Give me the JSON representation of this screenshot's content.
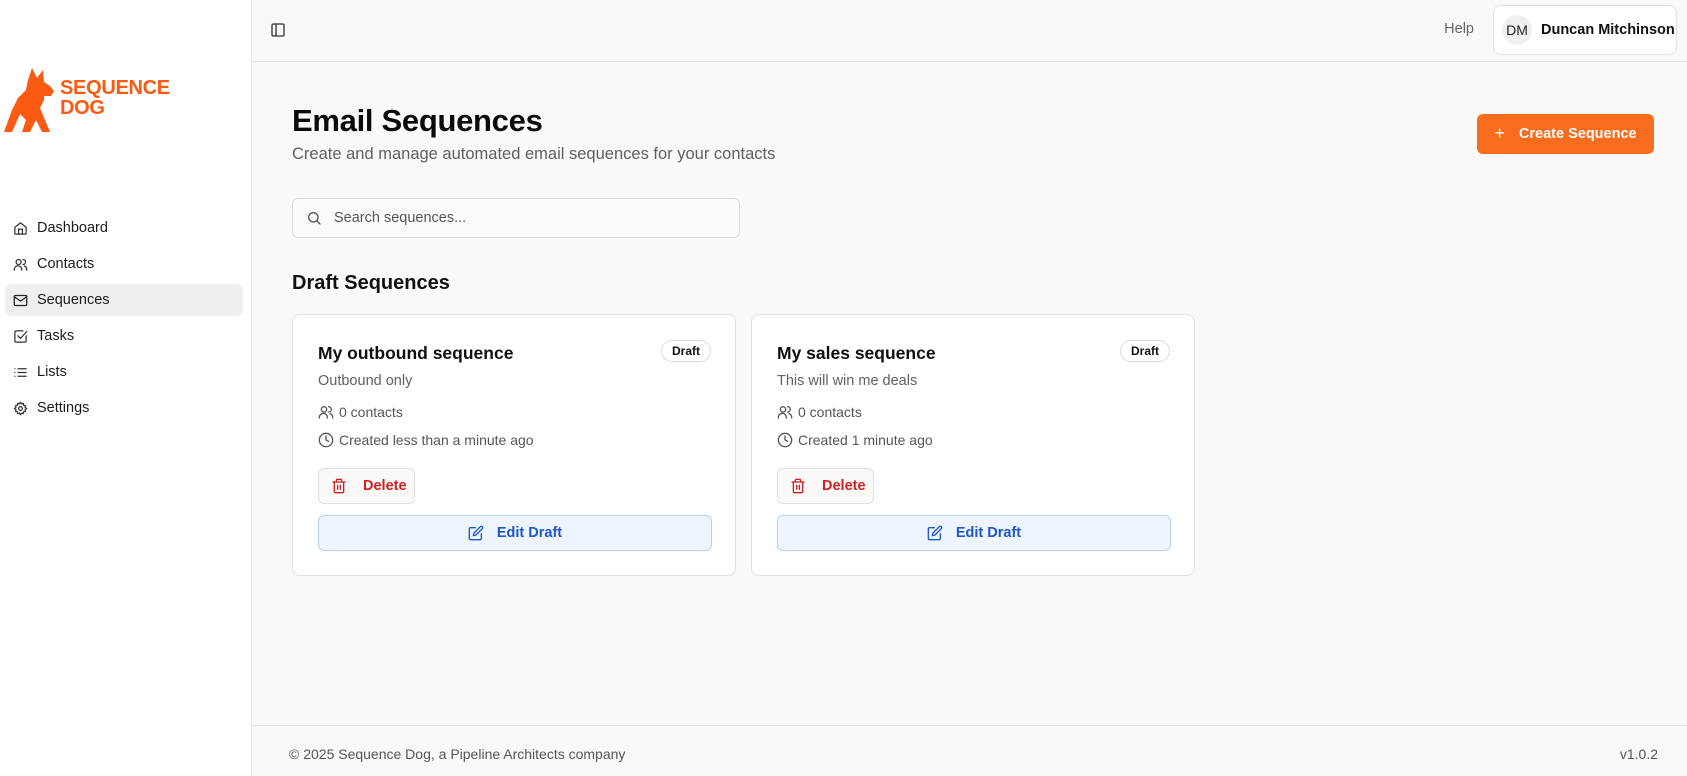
{
  "brand": {
    "line1": "SEQUENCE",
    "line2": "DOG",
    "color": "#fb5a12"
  },
  "sidebar": {
    "items": [
      {
        "label": "Dashboard",
        "icon": "home-icon"
      },
      {
        "label": "Contacts",
        "icon": "users-icon"
      },
      {
        "label": "Sequences",
        "icon": "mail-icon",
        "active": true
      },
      {
        "label": "Tasks",
        "icon": "check-square-icon"
      },
      {
        "label": "Lists",
        "icon": "list-icon"
      },
      {
        "label": "Settings",
        "icon": "gear-icon"
      }
    ]
  },
  "topbar": {
    "help_label": "Help",
    "user_initials": "DM",
    "user_name": "Duncan Mitchinson"
  },
  "page": {
    "title": "Email Sequences",
    "subtitle": "Create and manage automated email sequences for your contacts",
    "create_label": "Create Sequence",
    "accent": "#f86d1d"
  },
  "search": {
    "placeholder": "Search sequences...",
    "value": ""
  },
  "draft_section": {
    "title": "Draft Sequences",
    "cards": [
      {
        "title": "My outbound sequence",
        "badge": "Draft",
        "description": "Outbound only",
        "contacts": "0 contacts",
        "created": "Created less than a minute ago",
        "delete_label": "Delete",
        "edit_label": "Edit Draft"
      },
      {
        "title": "My sales sequence",
        "badge": "Draft",
        "description": "This will win me deals",
        "contacts": "0 contacts",
        "created": "Created 1 minute ago",
        "delete_label": "Delete",
        "edit_label": "Edit Draft"
      }
    ]
  },
  "footer": {
    "copyright": "© 2025 Sequence Dog, a Pipeline Architects company",
    "version": "v1.0.2"
  }
}
